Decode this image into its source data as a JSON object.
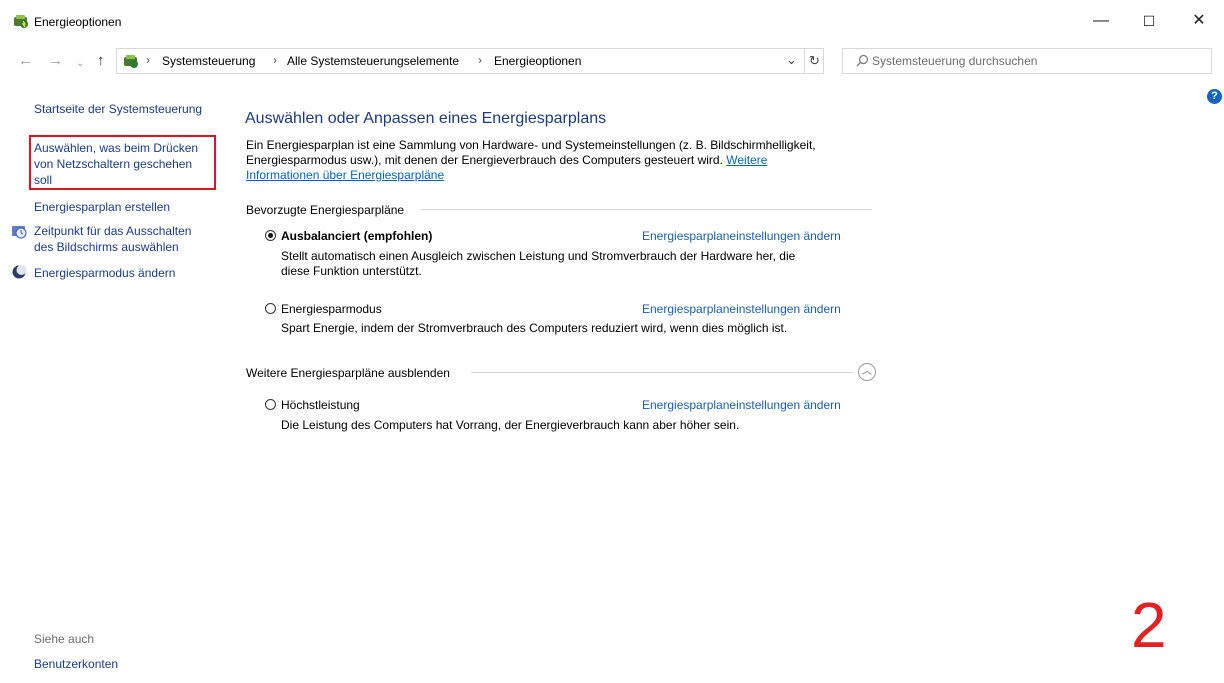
{
  "window": {
    "title": "Energieoptionen",
    "controls": {
      "minimize": "—",
      "maximize": "☐",
      "close": "✕"
    }
  },
  "address": {
    "crumbs": [
      "Systemsteuerung",
      "Alle Systemsteuerungselemente",
      "Energieoptionen"
    ],
    "separator": "›",
    "dropdown": "⌄",
    "refresh": "↻"
  },
  "search": {
    "placeholder": "Systemsteuerung durchsuchen"
  },
  "help": {
    "label": "?"
  },
  "sidebar": {
    "home": "Startseite der Systemsteuerung",
    "items": [
      {
        "label": "Auswählen, was beim Drücken von Netzschaltern geschehen soll",
        "lines": [
          "Auswählen, was beim Drücken",
          "von Netzschaltern geschehen",
          "soll"
        ]
      },
      {
        "label": "Energiesparplan erstellen"
      },
      {
        "lines": [
          "Zeitpunkt für das Ausschalten",
          "des Bildschirms auswählen"
        ]
      },
      {
        "label": "Energiesparmodus ändern"
      }
    ],
    "see_also_title": "Siehe auch",
    "see_also_items": [
      "Benutzerkonten"
    ]
  },
  "main": {
    "title": "Auswählen oder Anpassen eines Energiesparplans",
    "description_lines": [
      "Ein Energiesparplan ist eine Sammlung von Hardware- und Systemeinstellungen (z. B. Bildschirmhelligkeit,",
      "Energiesparmodus usw.), mit denen der Energieverbrauch des Computers gesteuert wird."
    ],
    "more_info_link_1": "Weitere",
    "more_info_link_2": "Informationen über Energiesparpläne",
    "preferred_label": "Bevorzugte Energiesparpläne",
    "more_plans_label": "Weitere Energiesparpläne ausblenden",
    "change_link": "Energiesparplaneinstellungen ändern",
    "plans": [
      {
        "name": "Ausbalanciert (empfohlen)",
        "selected": true,
        "desc_lines": [
          "Stellt automatisch einen Ausgleich zwischen Leistung und Stromverbrauch der Hardware her, die",
          "diese Funktion unterstützt."
        ]
      },
      {
        "name": "Energiesparmodus",
        "selected": false,
        "desc_lines": [
          "Spart Energie, indem der Stromverbrauch des Computers reduziert wird, wenn dies möglich ist."
        ]
      },
      {
        "name": "Höchstleistung",
        "selected": false,
        "desc_lines": [
          "Die Leistung des Computers hat Vorrang, der Energieverbrauch kann aber höher sein."
        ]
      }
    ]
  },
  "annotation": {
    "number": "2",
    "color": "#e62020"
  },
  "colors": {
    "accent": "#1e3a87",
    "link": "#0066cc",
    "highlight_border": "#e8111f"
  }
}
